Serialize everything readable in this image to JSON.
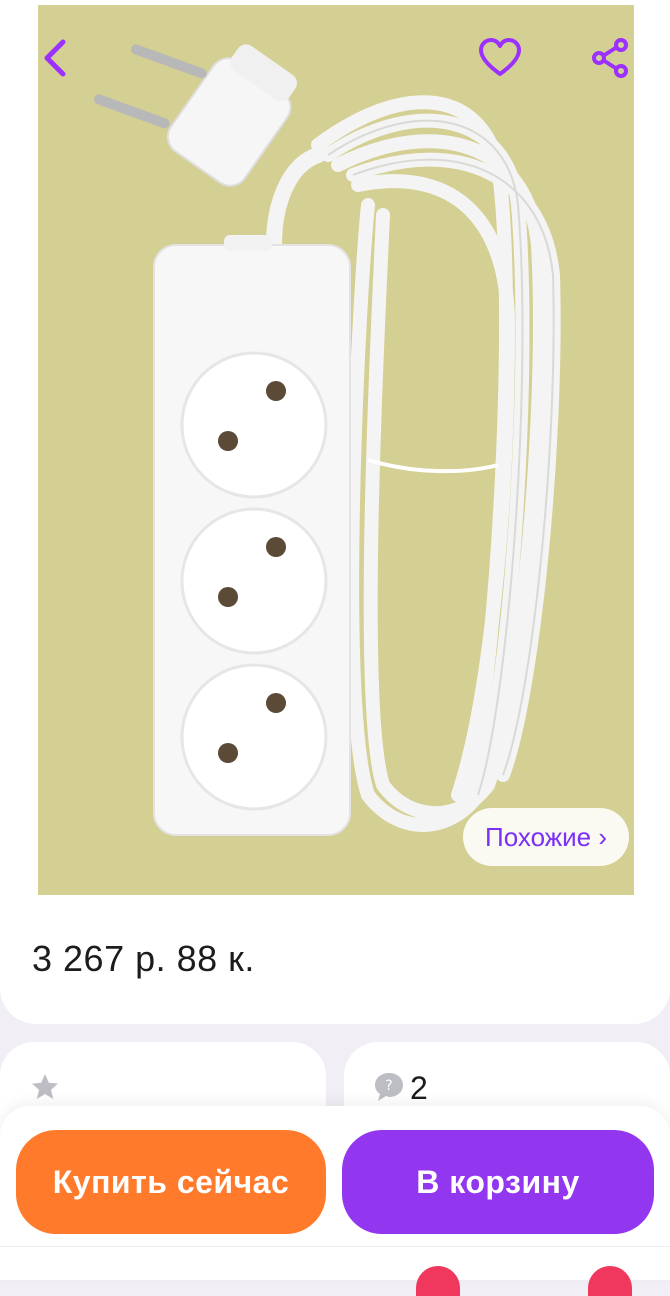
{
  "header": {
    "back_icon": "chevron-left-icon",
    "favorite_icon": "heart-icon",
    "share_icon": "share-icon",
    "icon_color": "#9b30ff"
  },
  "gallery": {
    "image_subject": "white three-socket extension cord with coiled cable",
    "similar_label": "Похожие ›"
  },
  "product": {
    "price": "3 267 р. 88 к."
  },
  "stats": {
    "rating_icon": "star-icon",
    "reviews_icon": "question-bubble-icon",
    "reviews_count": "2"
  },
  "actions": {
    "buy_now_label": "Купить сейчас",
    "buy_now_color": "#ff7a2a",
    "add_to_cart_label": "В корзину",
    "add_to_cart_color": "#9236f0"
  }
}
